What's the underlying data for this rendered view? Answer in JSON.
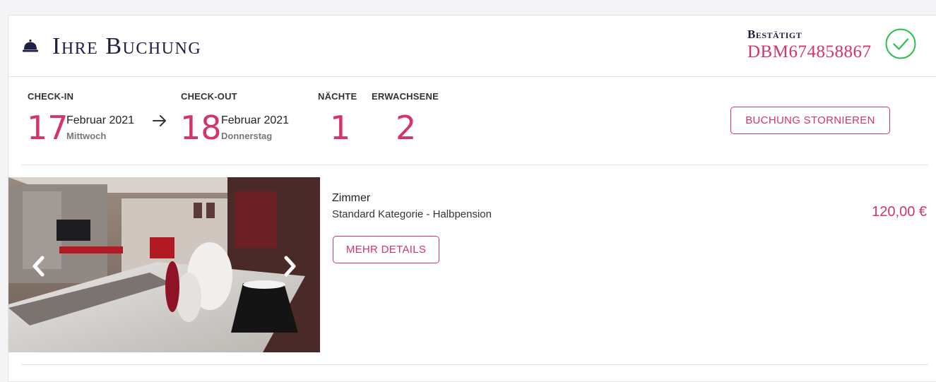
{
  "header": {
    "title": "Ihre Buchung",
    "status_label": "Bestätigt",
    "booking_number": "DBM674858867"
  },
  "checkin": {
    "label": "CHECK-IN",
    "day": "17",
    "month_year": "Februar 2021",
    "weekday": "Mittwoch"
  },
  "checkout": {
    "label": "CHECK-OUT",
    "day": "18",
    "month_year": "Februar 2021",
    "weekday": "Donnerstag"
  },
  "nights": {
    "label": "NÄCHTE",
    "value": "1"
  },
  "adults": {
    "label": "ERWACHSENE",
    "value": "2"
  },
  "cancel_button": "BUCHUNG STORNIEREN",
  "room": {
    "title": "Zimmer",
    "description": "Standard Kategorie - Halbpension",
    "price": "120,00 €",
    "details_button": "MEHR DETAILS"
  },
  "colors": {
    "accent": "#d6336c",
    "title": "#1f1f45",
    "confirmed_green": "#2bbf4a"
  },
  "icons": {
    "header": "service-bell-icon",
    "status": "check-circle-icon",
    "date_arrow": "arrow-right-icon",
    "carousel_prev": "chevron-left-icon",
    "carousel_next": "chevron-right-icon"
  }
}
